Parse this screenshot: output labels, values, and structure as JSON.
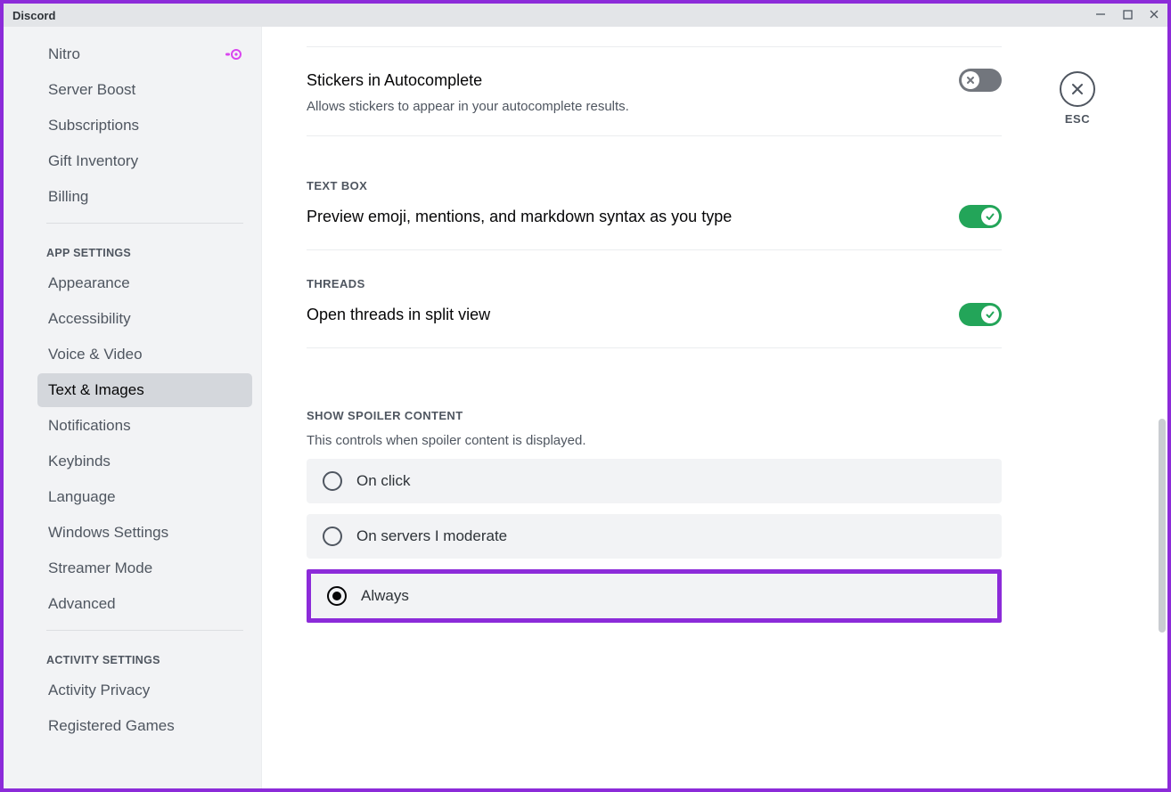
{
  "window": {
    "app_name": "Discord"
  },
  "close": {
    "esc_label": "ESC"
  },
  "sidebar": {
    "items_top": [
      {
        "label": "Nitro",
        "badge": "nitro"
      },
      {
        "label": "Server Boost"
      },
      {
        "label": "Subscriptions"
      },
      {
        "label": "Gift Inventory"
      },
      {
        "label": "Billing"
      }
    ],
    "header_app": "APP SETTINGS",
    "items_app": [
      {
        "label": "Appearance"
      },
      {
        "label": "Accessibility"
      },
      {
        "label": "Voice & Video"
      },
      {
        "label": "Text & Images",
        "active": true
      },
      {
        "label": "Notifications"
      },
      {
        "label": "Keybinds"
      },
      {
        "label": "Language"
      },
      {
        "label": "Windows Settings"
      },
      {
        "label": "Streamer Mode"
      },
      {
        "label": "Advanced"
      }
    ],
    "header_act": "ACTIVITY SETTINGS",
    "items_act": [
      {
        "label": "Activity Privacy"
      },
      {
        "label": "Registered Games"
      }
    ]
  },
  "settings": {
    "stickers": {
      "title": "Stickers in Autocomplete",
      "desc": "Allows stickers to appear in your autocomplete results.",
      "on": false
    },
    "textbox": {
      "header": "TEXT BOX",
      "title": "Preview emoji, mentions, and markdown syntax as you type",
      "on": true
    },
    "threads": {
      "header": "THREADS",
      "title": "Open threads in split view",
      "on": true
    },
    "spoiler": {
      "header": "SHOW SPOILER CONTENT",
      "desc": "This controls when spoiler content is displayed.",
      "options": [
        {
          "label": "On click",
          "selected": false
        },
        {
          "label": "On servers I moderate",
          "selected": false
        },
        {
          "label": "Always",
          "selected": true
        }
      ]
    }
  },
  "colors": {
    "accent_purple": "#8c2bd9",
    "toggle_on": "#23a559",
    "toggle_off": "#72767d"
  }
}
